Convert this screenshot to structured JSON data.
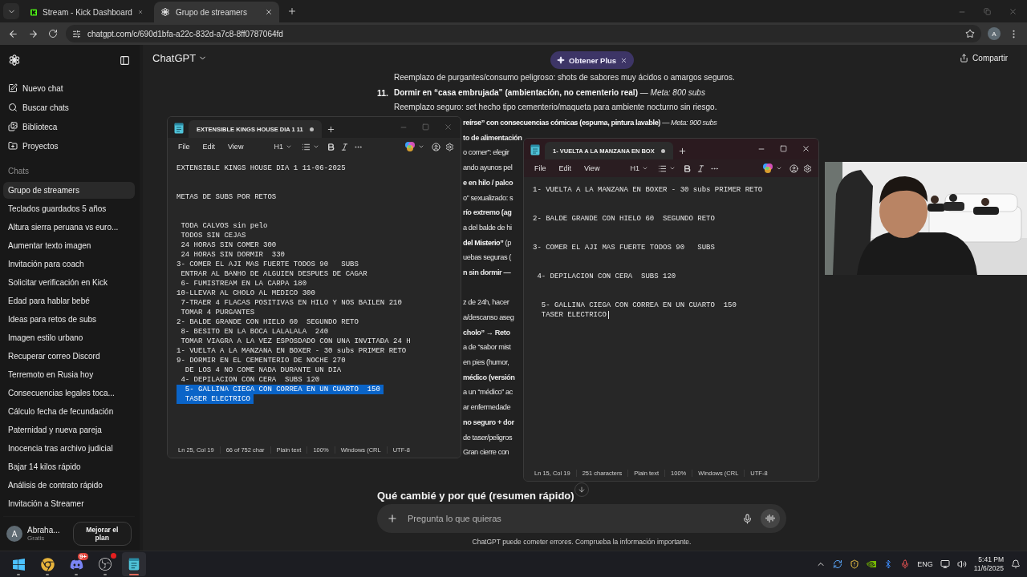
{
  "browser": {
    "tabs": [
      {
        "title": "Stream - Kick Dashboard",
        "selected": false
      },
      {
        "title": "Grupo de streamers",
        "selected": true
      }
    ],
    "url": "chatgpt.com/c/690d1bfa-a22c-832d-a7c8-8ff0787064fd",
    "profile_initial": "A"
  },
  "sidebar": {
    "nav": [
      "Nuevo chat",
      "Buscar chats",
      "Biblioteca",
      "Proyectos"
    ],
    "section": "Chats",
    "chats": [
      {
        "title": "Grupo de streamers",
        "selected": true
      },
      {
        "title": "Teclados guardados 5 años",
        "selected": false
      },
      {
        "title": "Altura sierra peruana vs euro...",
        "selected": false
      },
      {
        "title": "Aumentar texto imagen",
        "selected": false
      },
      {
        "title": "Invitación para coach",
        "selected": false
      },
      {
        "title": "Solicitar verificación en Kick",
        "selected": false
      },
      {
        "title": "Edad para hablar bebé",
        "selected": false
      },
      {
        "title": "Ideas para retos de subs",
        "selected": false
      },
      {
        "title": "Imagen estilo urbano",
        "selected": false
      },
      {
        "title": "Recuperar correo Discord",
        "selected": false
      },
      {
        "title": "Terremoto en Rusia hoy",
        "selected": false
      },
      {
        "title": "Consecuencias legales toca...",
        "selected": false
      },
      {
        "title": "Cálculo fecha de fecundación",
        "selected": false
      },
      {
        "title": "Paternidad y nueva pareja",
        "selected": false
      },
      {
        "title": "Inocencia tras archivo judicial",
        "selected": false
      },
      {
        "title": "Bajar 14 kilos rápido",
        "selected": false
      },
      {
        "title": "Análisis de contrato rápido",
        "selected": false
      },
      {
        "title": "Invitación a Streamer",
        "selected": false
      }
    ],
    "user": {
      "initial": "A",
      "name": "Abraha...",
      "plan": "Gratis"
    },
    "upgrade_button": "Mejorar el plan"
  },
  "header": {
    "title": "ChatGPT",
    "promo": "Obtener Plus",
    "share": "Compartir"
  },
  "chat": {
    "paragraphs": [
      {
        "lines": [
          {
            "kind": "body",
            "bold": false,
            "text": "Reemplazo de purgantes/consumo peligroso: shots de sabores muy ácidos o amargos seguros."
          },
          {
            "kind": "numbered",
            "bold": false,
            "number": "11.",
            "text": "**Dormir en “casa embrujada” (ambientación, no cementerio real)** — *Meta: 800 subs*"
          },
          {
            "kind": "body",
            "bold": false,
            "text": "Reemplazo seguro: set hecho tipo cementerio/maqueta para ambiente nocturno sin riesgo."
          },
          {
            "kind": "fragment",
            "bold": false,
            "text": "**reírse” con consecuencias cómicas (espuma, pintura lavable)** — *Meta: 900 subs*"
          },
          {
            "kind": "fragment",
            "bold": true,
            "text": "to de alimentación"
          },
          {
            "kind": "fragment",
            "bold": false,
            "text": "o comer”: elegir"
          },
          {
            "kind": "fragment",
            "bold": false,
            "text": "ando ayunos pel"
          },
          {
            "kind": "fragment",
            "bold": true,
            "text": "e en hilo / palco"
          },
          {
            "kind": "fragment",
            "bold": false,
            "text": "o” sexualizado: s"
          },
          {
            "kind": "fragment",
            "bold": true,
            "text": "río extremo (ag"
          },
          {
            "kind": "fragment",
            "bold": false,
            "text": "a del balde de hi"
          },
          {
            "kind": "fragment",
            "bold": false,
            "text": "**del Misterio”** (p"
          },
          {
            "kind": "fragment",
            "bold": false,
            "text": "uebas seguras ("
          },
          {
            "kind": "fragment",
            "bold": true,
            "text": "n sin dormir —"
          }
        ]
      },
      {
        "lines": [
          {
            "kind": "fragment",
            "bold": false,
            "text": "z de 24h, hacer"
          },
          {
            "kind": "fragment",
            "bold": false,
            "text": "a/descanso aseg"
          },
          {
            "kind": "fragment",
            "bold": true,
            "text": "cholo” → Reto"
          },
          {
            "kind": "fragment",
            "bold": false,
            "text": "a de “sabor mist"
          },
          {
            "kind": "fragment",
            "bold": false,
            "text": "en pies (humor,"
          },
          {
            "kind": "fragment",
            "bold": true,
            "text": "médico (versión"
          },
          {
            "kind": "fragment",
            "bold": false,
            "text": "a un “médico” ac"
          },
          {
            "kind": "fragment",
            "bold": false,
            "text": "ar enfermedade"
          },
          {
            "kind": "fragment",
            "bold": true,
            "text": "no seguro + dor"
          },
          {
            "kind": "fragment",
            "bold": false,
            "text": "de taser/peligros"
          },
          {
            "kind": "fragment",
            "bold": false,
            "text": "Gran cierre con"
          }
        ]
      }
    ],
    "heading": "Qué cambié y por qué (resumen rápido)",
    "placeholder": "Pregunta lo que quieras",
    "disclaimer": "ChatGPT puede cometer errores. Comprueba la información importante."
  },
  "notepads": [
    {
      "tab_title": "EXTENSIBLE KINGS HOUSE DIA 1 11",
      "unsaved": true,
      "active": false,
      "menu": [
        "File",
        "Edit",
        "View"
      ],
      "heading_level": "H1",
      "blocks": [
        {
          "lines": [
            {
              "text": "EXTENSIBLE KINGS HOUSE DIA 1 11-06-2025",
              "selected": false
            }
          ]
        },
        {
          "lines": [
            {
              "text": "METAS DE SUBS POR RETOS",
              "selected": false
            }
          ]
        },
        {
          "lines": [
            {
              "text": " TODA CALVOS sin pelo",
              "selected": false
            },
            {
              "text": " TODOS SIN CEJAS",
              "selected": false
            },
            {
              "text": " 24 HORAS SIN COMER 300",
              "selected": false
            },
            {
              "text": " 24 HORAS SIN DORMIR  330",
              "selected": false
            },
            {
              "text": "3- COMER EL AJI MAS FUERTE TODOS 90   SUBS",
              "selected": false
            },
            {
              "text": " ENTRAR AL BANHO DE ALGUIEN DESPUES DE CAGAR",
              "selected": false
            },
            {
              "text": " 6- FUMISTREAM EN LA CARPA 180",
              "selected": false
            },
            {
              "text": "10-LLEVAR AL CHOLO AL MEDICO 300",
              "selected": false
            },
            {
              "text": " 7-TRAER 4 FLACAS POSITIVAS EN HILO Y NOS BAILEN 210",
              "selected": false
            },
            {
              "text": " TOMAR 4 PURGANTES",
              "selected": false
            },
            {
              "text": "2- BALDE GRANDE CON HIELO 60  SEGUNDO RETO",
              "selected": false
            },
            {
              "text": " 8- BESITO EN LA BOCA LALALALA  240",
              "selected": false
            },
            {
              "text": " TOMAR VIAGRA A LA VEZ ESPOSDADO CON UNA INVITADA 24 H",
              "selected": false
            },
            {
              "text": "1- VUELTA A LA MANZANA EN BOXER - 30 subs PRIMER RETO",
              "selected": false
            },
            {
              "text": "9- DORMIR EN EL CEMENTERIO DE NOCHE 270",
              "selected": false
            },
            {
              "text": "  DE LOS 4 NO COME NADA DURANTE UN DIA",
              "selected": false
            },
            {
              "text": " 4- DEPILACION CON CERA  SUBS 120",
              "selected": false
            },
            {
              "text": "  5- GALLINA CIEGA CON CORREA EN UN CUARTO  150",
              "selected": true
            },
            {
              "text": "  TASER ELECTRICO",
              "selected": true
            }
          ]
        }
      ],
      "status": [
        "Ln 25, Col 19",
        "66 of 752 char",
        "Plain text",
        "100%",
        "Windows (CRL",
        "UTF-8"
      ]
    },
    {
      "tab_title": "1- VUELTA A LA MANZANA EN BOX",
      "unsaved": true,
      "active": true,
      "menu": [
        "File",
        "Edit",
        "View"
      ],
      "heading_level": "H1",
      "blocks": [
        {
          "lines": [
            {
              "text": "1- VUELTA A LA MANZANA EN BOXER - 30 subs PRIMER RETO",
              "selected": false
            }
          ]
        },
        {
          "lines": [
            {
              "text": "2- BALDE GRANDE CON HIELO 60  SEGUNDO RETO",
              "selected": false
            }
          ]
        },
        {
          "lines": [
            {
              "text": "3- COMER EL AJI MAS FUERTE TODOS 90   SUBS",
              "selected": false
            }
          ]
        },
        {
          "lines": [
            {
              "text": " 4- DEPILACION CON CERA  SUBS 120",
              "selected": false
            }
          ]
        },
        {
          "lines": [
            {
              "text": "  5- GALLINA CIEGA CON CORREA EN UN CUARTO  150",
              "selected": false
            },
            {
              "text": "  TASER ELECTRICO",
              "selected": false
            }
          ]
        }
      ],
      "status": [
        "Ln 15, Col 19",
        "251 characters",
        "Plain text",
        "100%",
        "Windows (CRL",
        "UTF-8"
      ]
    }
  ],
  "taskbar": {
    "apps": [
      {
        "active": false
      },
      {
        "active": false
      },
      {
        "active": false,
        "badge": "9+"
      },
      {
        "active": false,
        "alert": true
      },
      {
        "active": true
      }
    ],
    "language": "ENG",
    "time": "5:41 PM",
    "date": "11/6/2025"
  }
}
